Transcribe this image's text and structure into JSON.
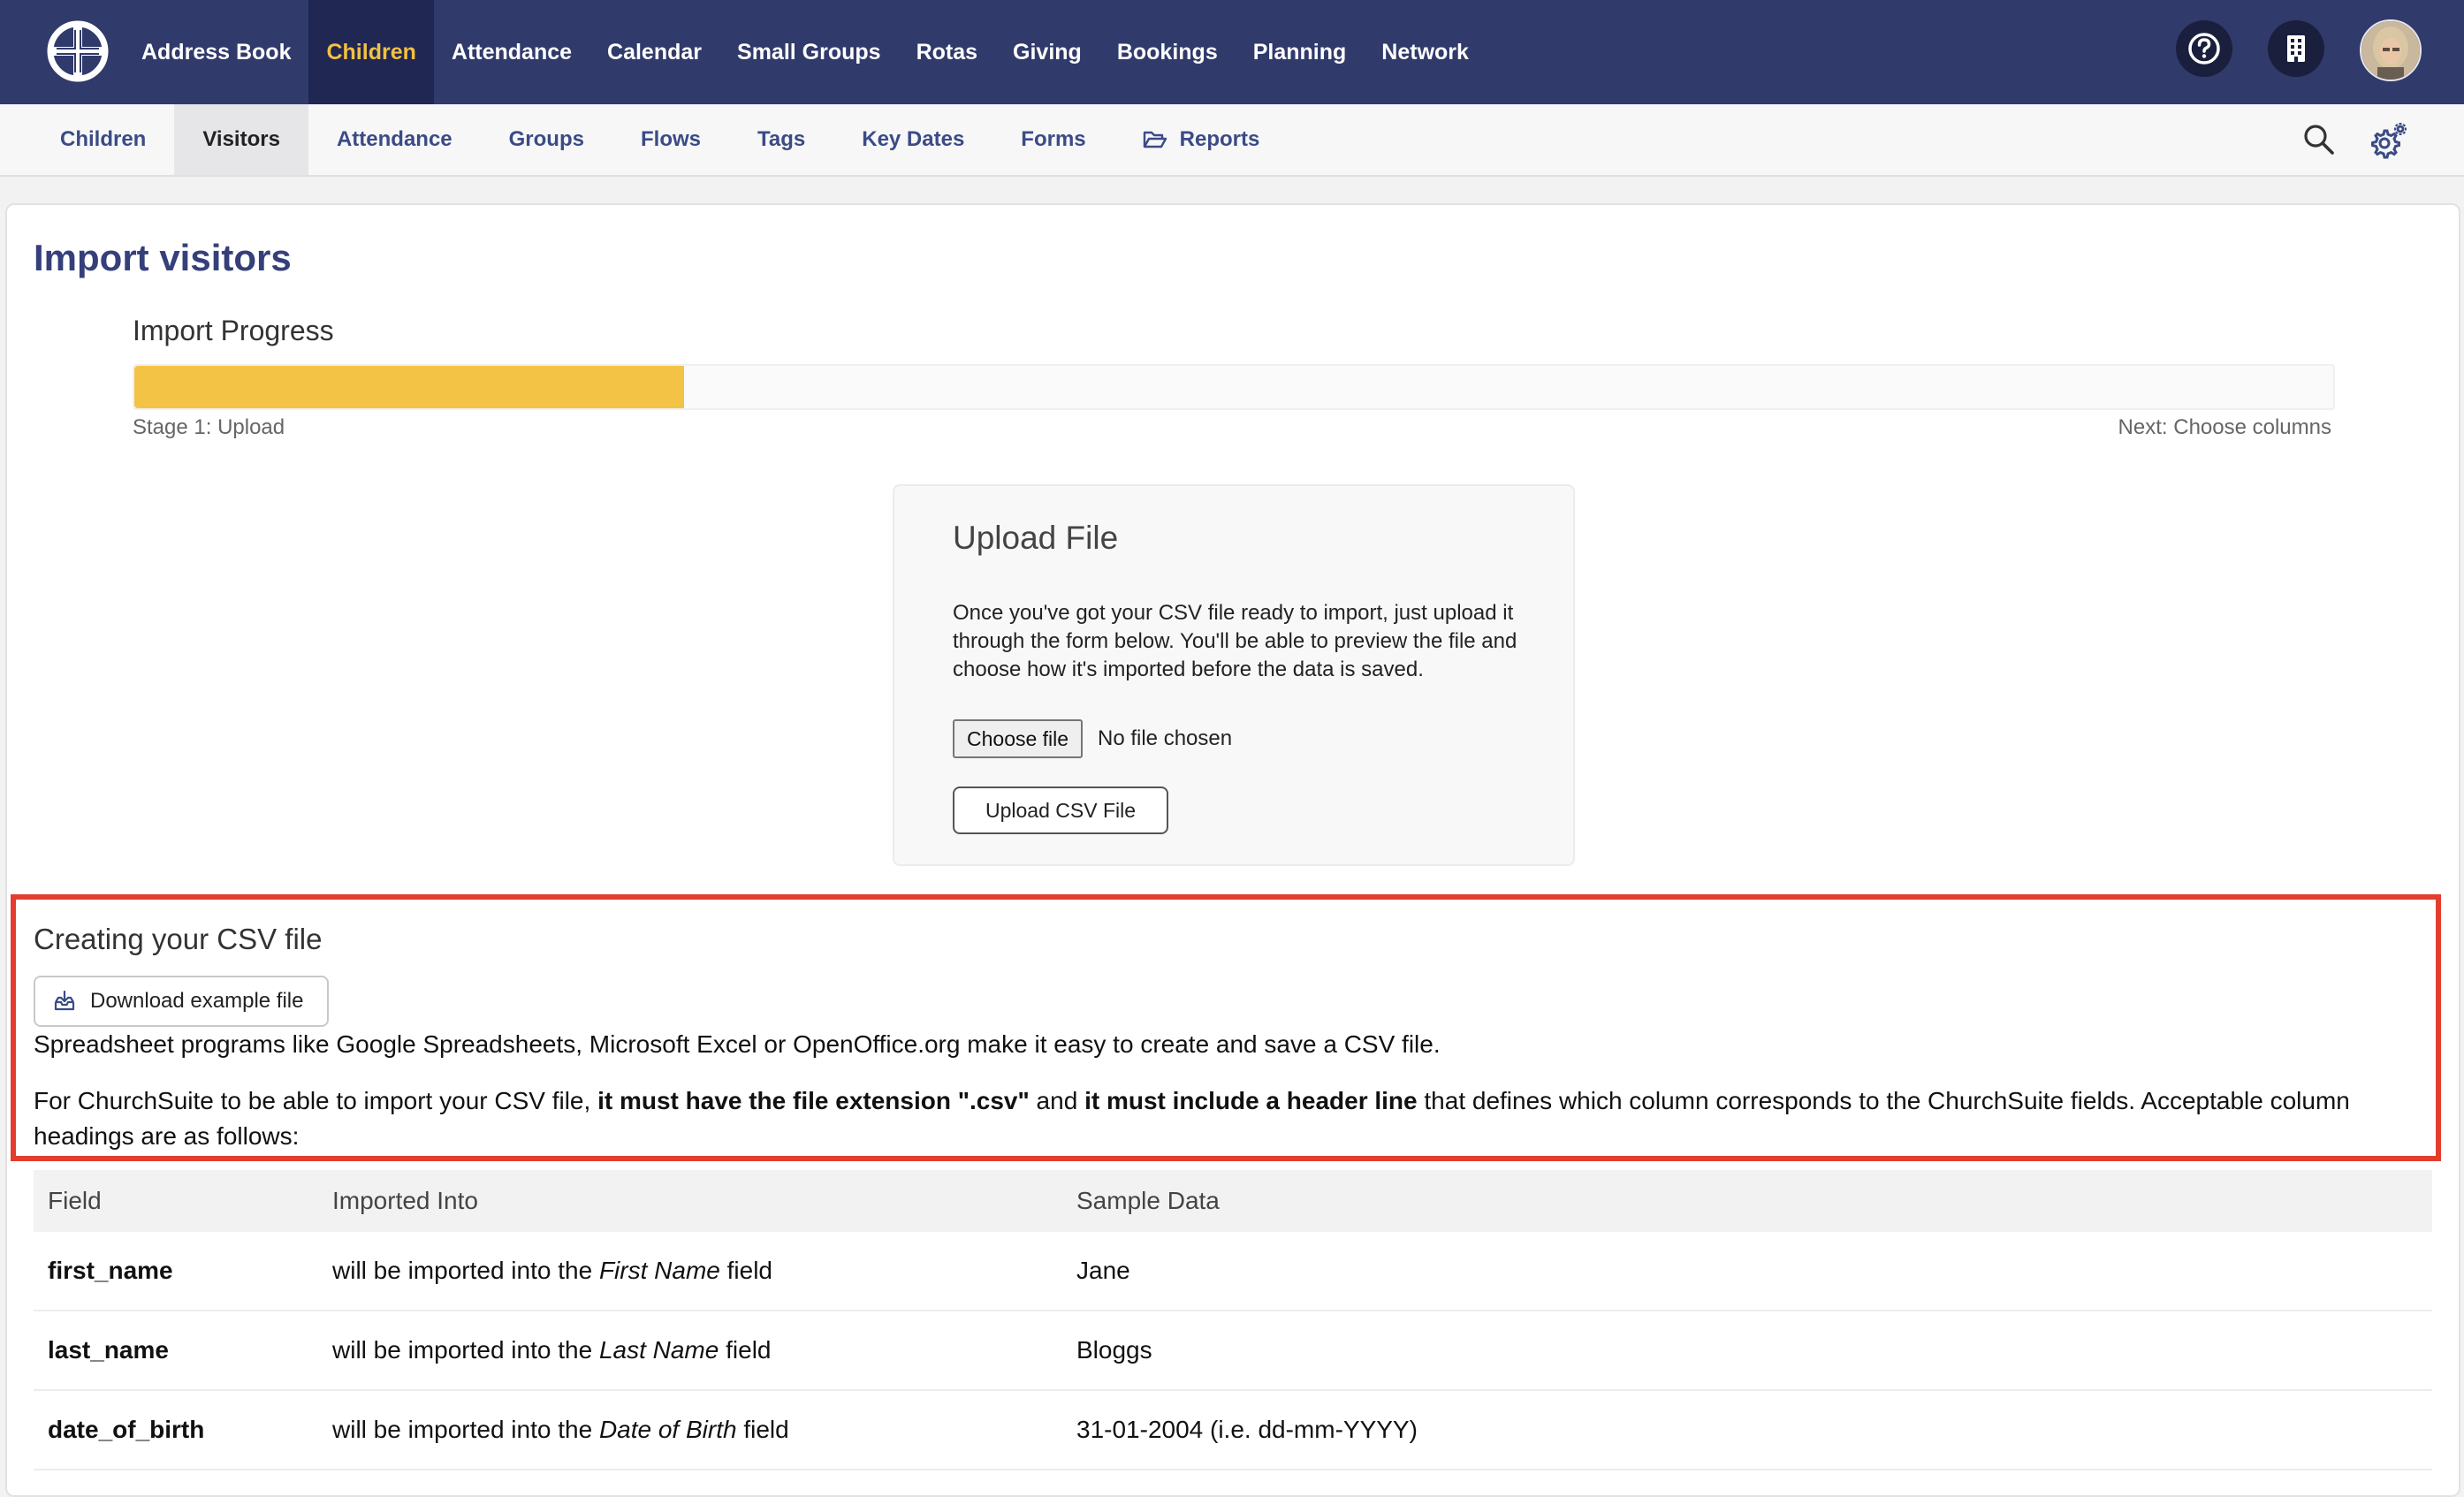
{
  "topnav": {
    "items": [
      {
        "label": "Address Book",
        "active": false
      },
      {
        "label": "Children",
        "active": true
      },
      {
        "label": "Attendance",
        "active": false
      },
      {
        "label": "Calendar",
        "active": false
      },
      {
        "label": "Small Groups",
        "active": false
      },
      {
        "label": "Rotas",
        "active": false
      },
      {
        "label": "Giving",
        "active": false
      },
      {
        "label": "Bookings",
        "active": false
      },
      {
        "label": "Planning",
        "active": false
      },
      {
        "label": "Network",
        "active": false
      }
    ],
    "active_color": "#f2c043",
    "background": "#303a6b"
  },
  "subnav": {
    "items": [
      {
        "label": "Children",
        "active": false
      },
      {
        "label": "Visitors",
        "active": true
      },
      {
        "label": "Attendance",
        "active": false
      },
      {
        "label": "Groups",
        "active": false
      },
      {
        "label": "Flows",
        "active": false
      },
      {
        "label": "Tags",
        "active": false
      },
      {
        "label": "Key Dates",
        "active": false
      },
      {
        "label": "Forms",
        "active": false
      },
      {
        "label": "Reports",
        "active": false,
        "icon": "folder-open-icon"
      }
    ]
  },
  "page": {
    "title": "Import visitors",
    "progress": {
      "label": "Import Progress",
      "fraction": 0.25,
      "stage_text": "Stage 1: Upload",
      "next_text": "Next: Choose columns",
      "color": "#f2c345"
    }
  },
  "upload": {
    "title": "Upload File",
    "description": "Once you've got your CSV file ready to import, just upload it through the form below. You'll be able to preview the file and choose how it's imported before the data is saved.",
    "choose_label": "Choose file",
    "no_file_text": "No file chosen",
    "upload_label": "Upload CSV File"
  },
  "csv": {
    "title": "Creating your CSV file",
    "download_label": "Download example file",
    "p1": "Spreadsheet programs like Google Spreadsheets, Microsoft Excel or OpenOffice.org make it easy to create and save a CSV file.",
    "p2_a": "For ChurchSuite to be able to import your CSV file, ",
    "p2_b": "it must have the file extension \".csv\"",
    "p2_c": " and ",
    "p2_d": "it must include a header line",
    "p2_e": " that defines which column corresponds to the ChurchSuite fields. Acceptable column headings are as follows:",
    "highlight_color": "#e43d2d"
  },
  "table": {
    "headers": [
      "Field",
      "Imported Into",
      "Sample Data"
    ],
    "rows": [
      {
        "field": "first_name",
        "into_pre": "will be imported into the ",
        "into_field": "First Name",
        "into_post": " field",
        "sample": "Jane"
      },
      {
        "field": "last_name",
        "into_pre": "will be imported into the ",
        "into_field": "Last Name",
        "into_post": " field",
        "sample": "Bloggs"
      },
      {
        "field": "date_of_birth",
        "into_pre": "will be imported into the ",
        "into_field": "Date of Birth",
        "into_post": " field",
        "sample": "31-01-2004 (i.e. dd-mm-YYYY)"
      }
    ]
  }
}
